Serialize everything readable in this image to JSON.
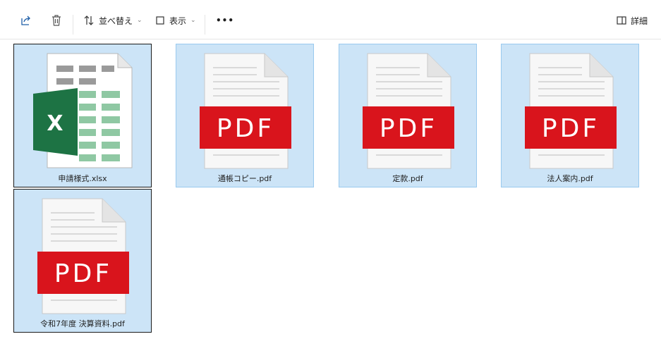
{
  "toolbar": {
    "sort_label": "並べ替え",
    "view_label": "表示",
    "more_label": "•••",
    "details_label": "詳細"
  },
  "files": [
    {
      "name": "申請様式.xlsx",
      "type": "excel",
      "badge": "X"
    },
    {
      "name": "通帳コピー.pdf",
      "type": "pdf",
      "badge": "PDF"
    },
    {
      "name": "定款.pdf",
      "type": "pdf",
      "badge": "PDF"
    },
    {
      "name": "法人案内.pdf",
      "type": "pdf",
      "badge": "PDF"
    },
    {
      "name": "令和7年度 決算資料.pdf",
      "type": "pdf",
      "badge": "PDF"
    }
  ],
  "colors": {
    "selection": "#cce4f7",
    "pdf_red": "#d9141c",
    "excel_green": "#1d7344",
    "excel_cells": "#8fc8a3"
  }
}
